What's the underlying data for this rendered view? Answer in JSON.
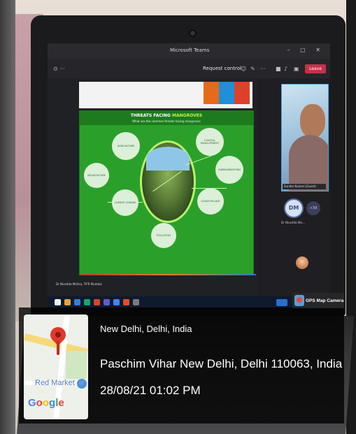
{
  "teams": {
    "window_title": "Microsoft Teams",
    "request_control": "Request control",
    "leave_label": "Leave",
    "video_name": "Sundar Kumari (Guest)",
    "avatar_initials": "DM",
    "more_participants": "+39",
    "avatar_name": "Dr Nivedita Mis...",
    "presenter_label": "Dr Nivedita Mishra, TIFR Mumbai"
  },
  "slide": {
    "title_prefix": "THREATS FACING ",
    "title_highlight": "MANGROVES",
    "subtitle": "What are the common threats facing mangroves",
    "bubbles": [
      "AGRICULTURE",
      "COASTAL DEVELOPMENT",
      "AQUACULTURE",
      "OVERHARVESTING",
      "CLIMATE CHANGE",
      "CLEAR FELLING",
      "POLLUTION"
    ]
  },
  "gps": {
    "badge": "GPS Map Camera",
    "city_line": "New Delhi, Delhi, India",
    "address_line": "Paschim Vihar New Delhi, Delhi 110063, India",
    "datetime_line": "28/08/21 01:02 PM",
    "map_label": "Red Market"
  }
}
